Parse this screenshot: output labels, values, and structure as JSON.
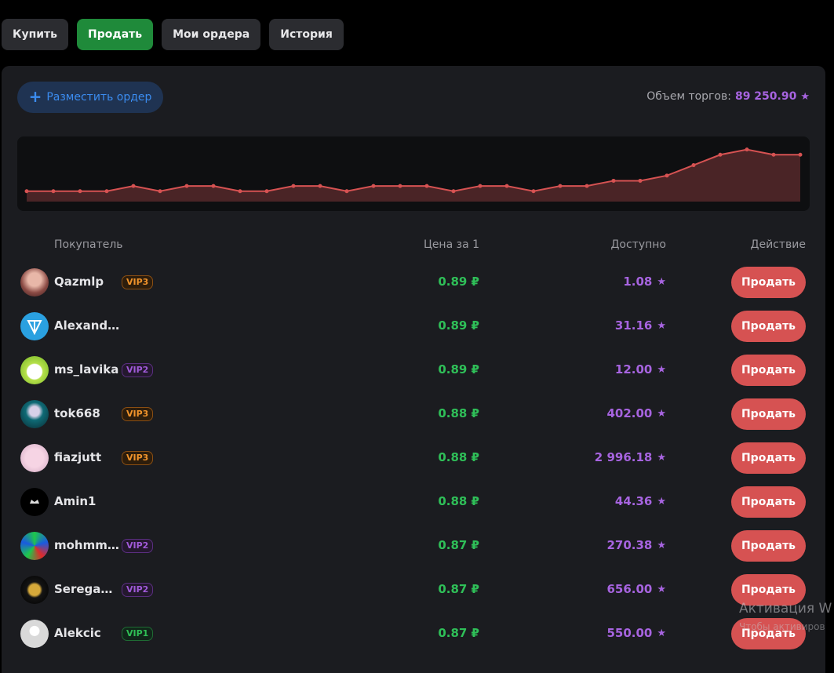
{
  "tabs": [
    {
      "label": "Купить",
      "active": false
    },
    {
      "label": "Продать",
      "active": true
    },
    {
      "label": "Мои ордера",
      "active": false
    },
    {
      "label": "История",
      "active": false
    }
  ],
  "place_order": {
    "label": "Разместить ордер",
    "icon": "plus-icon"
  },
  "volume": {
    "label": "Объем торгов:",
    "value": "89 250.90",
    "icon": "star-icon"
  },
  "chart_data": {
    "type": "area",
    "values": [
      0.8,
      0.8,
      0.8,
      0.8,
      0.81,
      0.8,
      0.81,
      0.81,
      0.8,
      0.8,
      0.81,
      0.81,
      0.8,
      0.81,
      0.81,
      0.81,
      0.8,
      0.81,
      0.81,
      0.8,
      0.81,
      0.81,
      0.82,
      0.82,
      0.83,
      0.85,
      0.87,
      0.88,
      0.87,
      0.87
    ],
    "title": "",
    "xlabel": "",
    "ylabel": ""
  },
  "columns": {
    "buyer": "Покупатель",
    "price": "Цена за 1",
    "available": "Доступно",
    "action": "Действие"
  },
  "rows": [
    {
      "name": "Qazmlp",
      "vip": "VIP3",
      "vip_level": 3,
      "price": "0.89 ₽",
      "available": "1.08",
      "action": "Продать"
    },
    {
      "name": "Alexandr...",
      "vip": "",
      "vip_level": 0,
      "price": "0.89 ₽",
      "available": "31.16",
      "action": "Продать"
    },
    {
      "name": "ms_lavika",
      "vip": "VIP2",
      "vip_level": 2,
      "price": "0.89 ₽",
      "available": "12.00",
      "action": "Продать"
    },
    {
      "name": "tok668",
      "vip": "VIP3",
      "vip_level": 3,
      "price": "0.88 ₽",
      "available": "402.00",
      "action": "Продать"
    },
    {
      "name": "fiazjutt",
      "vip": "VIP3",
      "vip_level": 3,
      "price": "0.88 ₽",
      "available": "2 996.18",
      "action": "Продать"
    },
    {
      "name": "Amin1",
      "vip": "",
      "vip_level": 0,
      "price": "0.88 ₽",
      "available": "44.36",
      "action": "Продать"
    },
    {
      "name": "mohmm...",
      "vip": "VIP2",
      "vip_level": 2,
      "price": "0.87 ₽",
      "available": "270.38",
      "action": "Продать"
    },
    {
      "name": "Seregamal",
      "vip": "VIP2",
      "vip_level": 2,
      "price": "0.87 ₽",
      "available": "656.00",
      "action": "Продать"
    },
    {
      "name": "Alekcic",
      "vip": "VIP1",
      "vip_level": 1,
      "price": "0.87 ₽",
      "available": "550.00",
      "action": "Продать"
    }
  ],
  "colors": {
    "accent_green": "#1f8a3a",
    "price_green": "#2fbf58",
    "purple": "#a764e0",
    "sell_red": "#d65252",
    "chart_line": "#d65252"
  },
  "watermark": {
    "title": "Активация W",
    "subtitle": "Чтобы активиров"
  }
}
